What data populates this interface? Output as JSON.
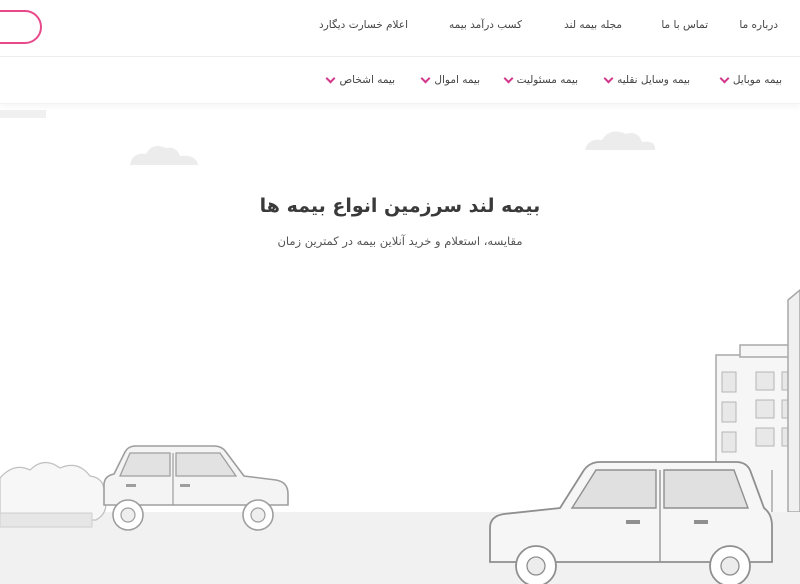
{
  "header": {
    "nav": [
      {
        "label": "درباره ما"
      },
      {
        "label": "تماس با ما"
      },
      {
        "label": "مجله بیمه لند"
      },
      {
        "label": "کسب درآمد بیمه"
      },
      {
        "label": "اعلام خسارت دیگارد"
      }
    ]
  },
  "categories": [
    {
      "label": "بیمه موبایل"
    },
    {
      "label": "بیمه وسایل نقلیه"
    },
    {
      "label": "بیمه مسئولیت"
    },
    {
      "label": "بیمه اموال"
    },
    {
      "label": "بیمه اشخاص"
    }
  ],
  "hero": {
    "title": "بیمه لند سرزمین انواع بیمه ها",
    "subtitle": "مقایسه، استعلام و خرید آنلاین بیمه در کمترین زمان"
  },
  "colors": {
    "accent": "#e8498a",
    "chevron": "#d2378a",
    "illustration_stroke": "#9e9e9e",
    "illustration_fill": "#f3f3f3"
  }
}
